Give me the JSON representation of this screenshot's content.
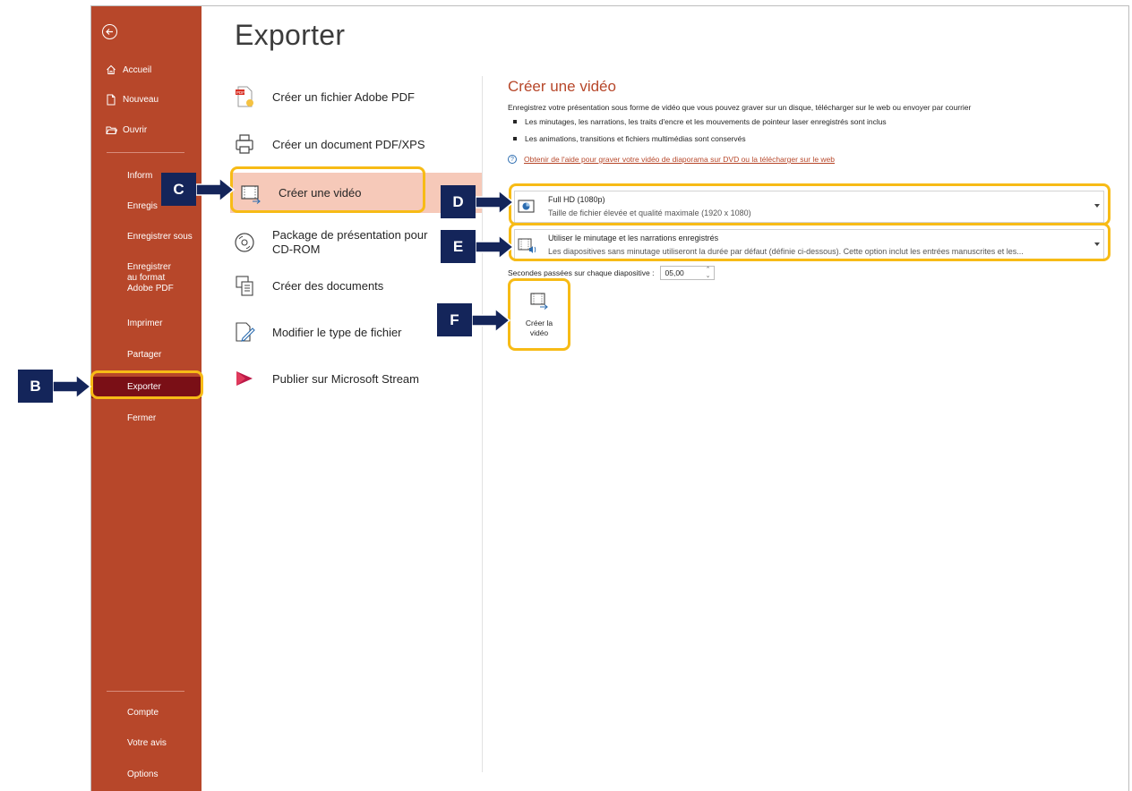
{
  "sidebar": {
    "back": "back",
    "top_items": [
      {
        "label": "Accueil",
        "icon": "home-icon"
      },
      {
        "label": "Nouveau",
        "icon": "new-document-icon"
      },
      {
        "label": "Ouvrir",
        "icon": "open-folder-icon"
      }
    ],
    "items": [
      {
        "label": "Inform"
      },
      {
        "label": "Enregis"
      },
      {
        "label": "Enregistrer sous"
      },
      {
        "label": "Enregistrer au format Adobe PDF"
      },
      {
        "label": "Imprimer"
      },
      {
        "label": "Partager"
      },
      {
        "label": "Exporter",
        "active": true
      },
      {
        "label": "Fermer"
      }
    ],
    "bottom_items": [
      {
        "label": "Compte"
      },
      {
        "label": "Votre avis"
      },
      {
        "label": "Options"
      }
    ],
    "accent_color": "#b7472a",
    "active_color": "#7a0f16"
  },
  "export": {
    "title": "Exporter",
    "options": [
      {
        "label": "Créer un fichier Adobe PDF",
        "icon": "adobe-pdf-icon"
      },
      {
        "label": "Créer un document PDF/XPS",
        "icon": "pdf-xps-icon"
      },
      {
        "label": "Créer une vidéo",
        "icon": "video-icon",
        "selected": true
      },
      {
        "label": "Package de présentation pour CD-ROM",
        "icon": "cd-rom-icon"
      },
      {
        "label": "Créer des documents",
        "icon": "handouts-icon"
      },
      {
        "label": "Modifier le type de fichier",
        "icon": "change-file-type-icon"
      },
      {
        "label": "Publier sur Microsoft Stream",
        "icon": "microsoft-stream-icon"
      }
    ]
  },
  "video": {
    "title": "Créer une vidéo",
    "description": "Enregistrez votre présentation sous forme de vidéo que vous pouvez graver sur un disque, télécharger sur le web ou envoyer par courrier",
    "bullets": [
      "Les minutages, les narrations, les traits d'encre et les mouvements de pointeur laser enregistrés sont inclus",
      "Les animations, transitions et fichiers multimédias sont conservés"
    ],
    "help_link": "Obtenir de l'aide pour graver votre vidéo de diaporama sur DVD ou la télécharger sur le web",
    "quality": {
      "title": "Full HD (1080p)",
      "subtitle": "Taille de fichier élevée et qualité maximale (1920 x 1080)"
    },
    "timing": {
      "title": "Utiliser le minutage et les narrations enregistrés",
      "subtitle": "Les diapositives sans minutage utiliseront la durée par défaut (définie ci-dessous). Cette option inclut les entrées manuscrites et les..."
    },
    "seconds_label": "Secondes passées sur chaque diapositive :",
    "seconds_value": "05,00",
    "create_button_line1": "Créer la",
    "create_button_line2": "vidéo"
  },
  "callouts": {
    "b": "B",
    "c": "C",
    "d": "D",
    "e": "E",
    "f": "F",
    "highlight_color": "#f7bb16",
    "label_color": "#14255a"
  }
}
